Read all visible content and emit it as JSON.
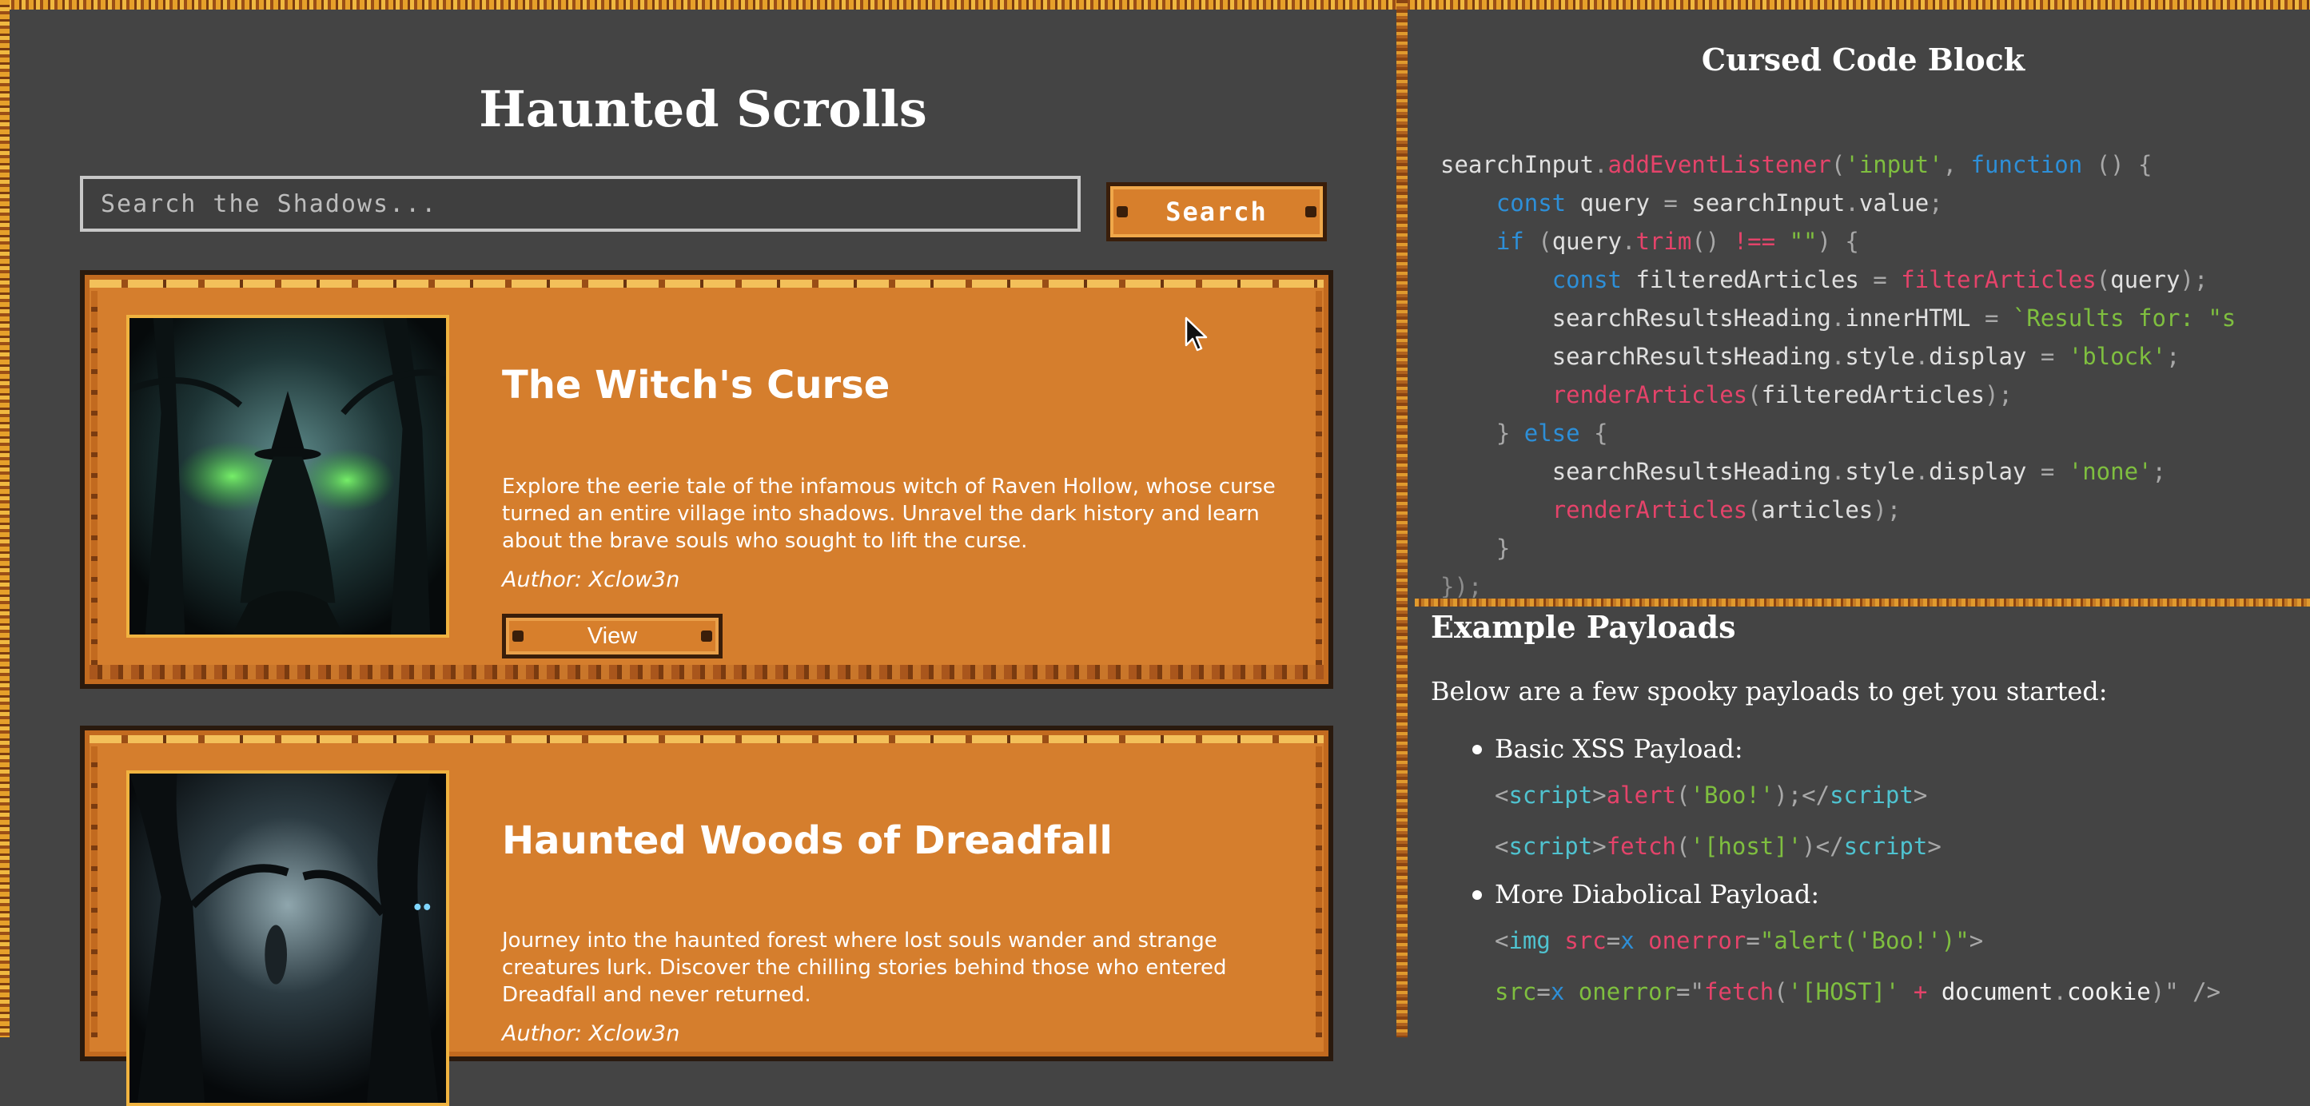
{
  "left": {
    "title": "Haunted Scrolls",
    "search": {
      "placeholder": "Search the Shadows...",
      "value": "",
      "button_label": "Search"
    },
    "articles": [
      {
        "title": "The Witch's Curse",
        "description": "Explore the eerie tale of the infamous witch of Raven Hollow, whose curse turned an entire village into shadows. Unravel the dark history and learn about the brave souls who sought to lift the curse.",
        "author": "Author: Xclow3n",
        "button_label": "View"
      },
      {
        "title": "Haunted Woods of Dreadfall",
        "description": "Journey into the haunted forest where lost souls wander and strange creatures lurk. Discover the chilling stories behind those who entered Dreadfall and never returned.",
        "author": "Author: Xclow3n",
        "button_label": "View"
      }
    ]
  },
  "right": {
    "code_title": "Cursed Code Block",
    "code": {
      "searchInput": "searchInput",
      "addEventListener": "addEventListener",
      "input_str": "'input'",
      "function_kw": "function",
      "const_kw": "const",
      "query": "query",
      "value": "value",
      "if_kw": "if",
      "trim": "trim",
      "empty_str": "\"\"",
      "filteredArticles": "filteredArticles",
      "filterArticles": "filterArticles",
      "searchResultsHeading": "searchResultsHeading",
      "innerHTML": "innerHTML",
      "results_str": "`Results for: \"s",
      "style": "style",
      "display": "display",
      "block_str": "'block'",
      "renderArticles": "renderArticles",
      "else_kw": "else",
      "none_str": "'none'",
      "articles": "articles"
    },
    "payloads": {
      "title": "Example Payloads",
      "intro": "Below are a few spooky payloads to get you started:",
      "groups": [
        {
          "label": "Basic XSS Payload:"
        },
        {
          "label": "More Diabolical Payload:"
        }
      ],
      "tokens": {
        "script": "script",
        "alert": "alert",
        "boo_str": "'Boo!'",
        "fetch": "fetch",
        "host_str": "'[host]'",
        "img": "img",
        "src": "src",
        "x": "x",
        "onerror": "onerror",
        "alert_attr": "\"alert('Boo!')\"",
        "HOST_str": "'[HOST]'",
        "document": "document",
        "cookie": "cookie"
      }
    }
  },
  "colors": {
    "background": "#444444",
    "card": "#d57e2d",
    "border": "#e6a02a",
    "text": "#ffffff"
  }
}
